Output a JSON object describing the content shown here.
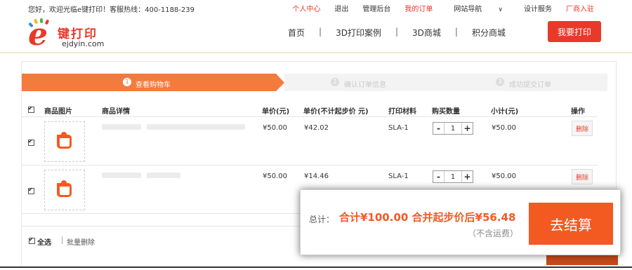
{
  "topbar": {
    "welcome": "您好，欢迎光临e键打印！客服热线：400-1188-239",
    "links": [
      "个人中心",
      "退出",
      "管理后台",
      "我的订单",
      "网站导航",
      "设计服务",
      "厂商入驻"
    ]
  },
  "logo": {
    "mark": "e",
    "name": "键打印",
    "domain": "ejdyin.com"
  },
  "nav": {
    "items": [
      "首页",
      "3D打印案例",
      "3D商城",
      "积分商城"
    ],
    "separator": "|",
    "cta": "我要打印"
  },
  "steps": [
    {
      "num": "1",
      "label": "查看购物车"
    },
    {
      "num": "2",
      "label": "确认订单信息"
    },
    {
      "num": "3",
      "label": "成功提交订单"
    }
  ],
  "table": {
    "headers": [
      "商品图片",
      "商品详情",
      "单价(元)",
      "单价(不计起步价 元)",
      "打印材料",
      "购买数量",
      "小计(元)",
      "操作"
    ],
    "rows": [
      {
        "price": "¥50.00",
        "price_no_base": "¥42.02",
        "material": "SLA-1",
        "qty": "1",
        "subtotal": "¥50.00",
        "action": "删除"
      },
      {
        "price": "¥50.00",
        "price_no_base": "¥14.46",
        "material": "SLA-1",
        "qty": "1",
        "subtotal": "¥50.00",
        "action": "删除"
      }
    ],
    "stepper_minus": "-",
    "stepper_plus": "+"
  },
  "footer": {
    "select_all": "全选",
    "bulk_delete": "批量删除"
  },
  "summary": {
    "label": "总计：",
    "total": "合计¥100.00 合并起步价后¥56.48",
    "note": "（不含运费）",
    "checkout": "去结算"
  },
  "colors": {
    "accent": "#e8392b",
    "step": "#f47b3e",
    "checkout": "#f25a22"
  }
}
